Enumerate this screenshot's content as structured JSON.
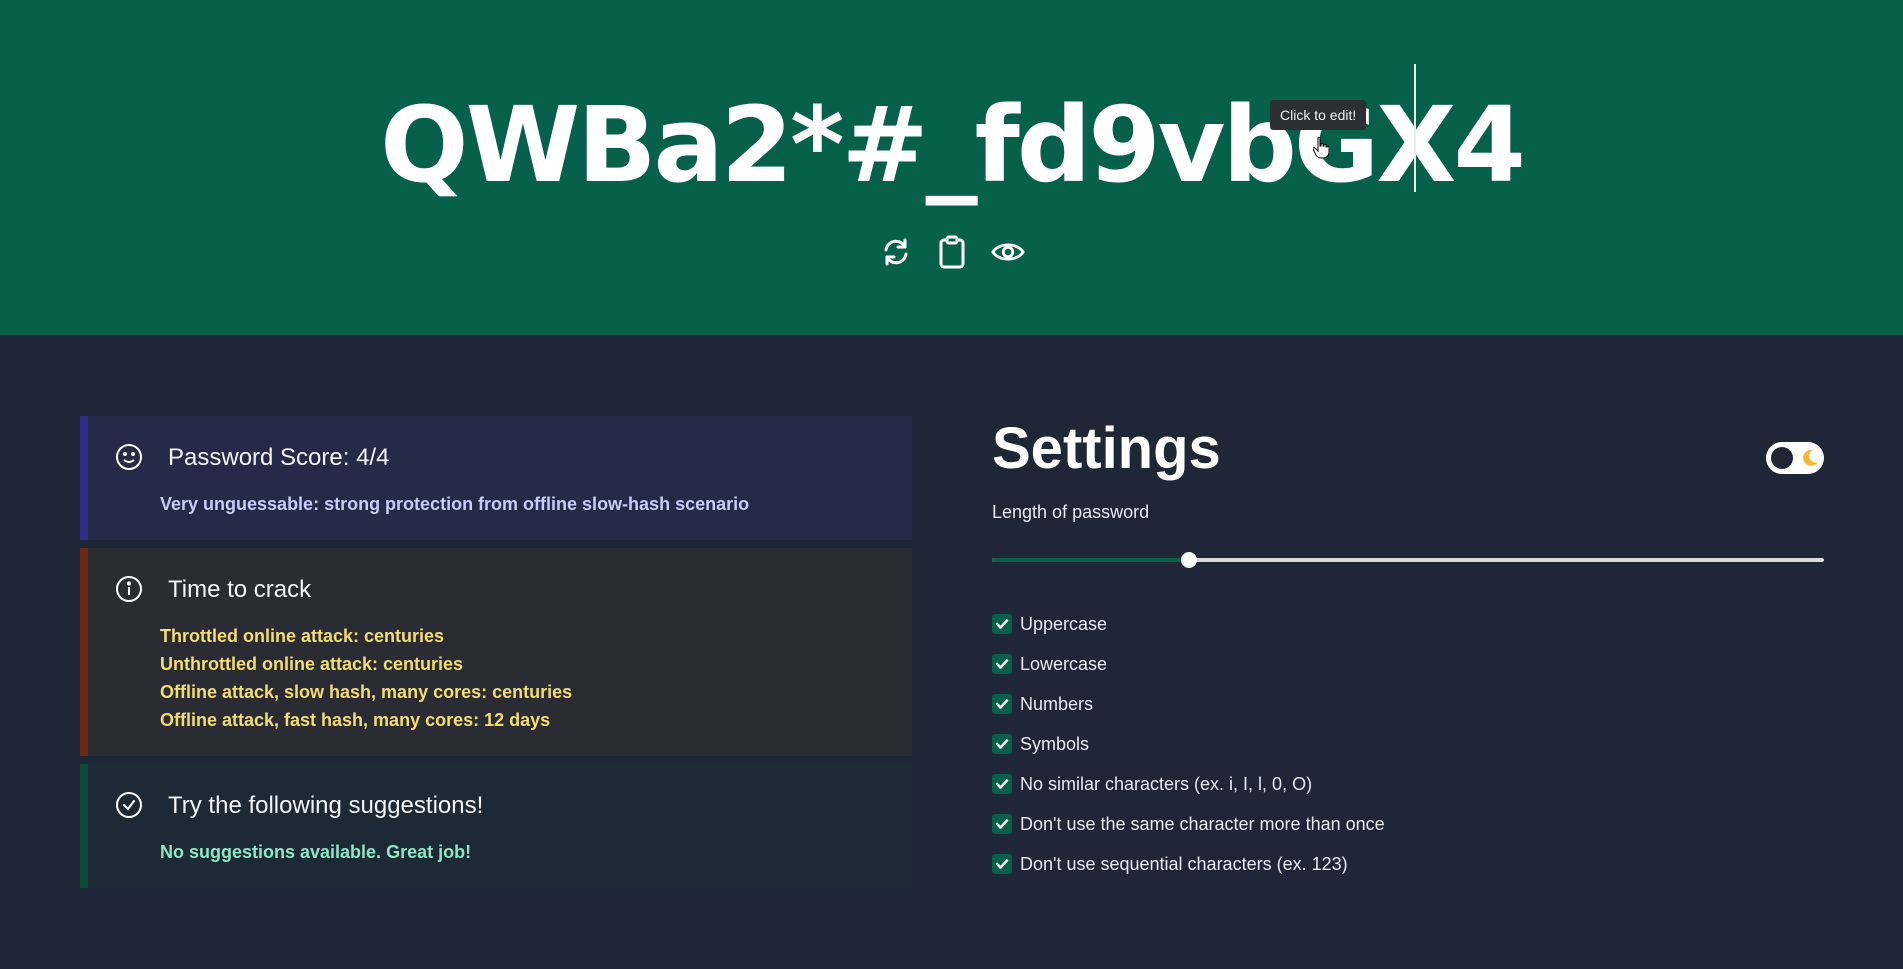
{
  "password": {
    "value": "QWBa2*#_fd9vbGX4",
    "tooltip": "Click to edit!"
  },
  "actions": [
    {
      "name": "regenerate-icon"
    },
    {
      "name": "clipboard-icon"
    },
    {
      "name": "eye-icon"
    }
  ],
  "cards": {
    "score": {
      "icon": "smile-icon",
      "title": "Password Score: 4/4",
      "lines": [
        "Very unguessable: strong protection from offline slow-hash scenario"
      ]
    },
    "crack": {
      "icon": "info-icon",
      "title": "Time to crack",
      "lines": [
        "Throttled online attack: centuries",
        "Unthrottled online attack: centuries",
        "Offline attack, slow hash, many cores: centuries",
        "Offline attack, fast hash, many cores: 12 days"
      ]
    },
    "suggestions": {
      "icon": "check-circle-icon",
      "title": "Try the following suggestions!",
      "lines": [
        "No suggestions available. Great job!"
      ]
    }
  },
  "settings": {
    "title": "Settings",
    "theme_toggle": {
      "state": "dark",
      "icon": "moon-icon"
    },
    "length_label": "Length of password",
    "length_fraction": 0.237,
    "options": [
      {
        "label": "Uppercase",
        "checked": true
      },
      {
        "label": "Lowercase",
        "checked": true
      },
      {
        "label": "Numbers",
        "checked": true
      },
      {
        "label": "Symbols",
        "checked": true
      },
      {
        "label": "No similar characters (ex. i, I, l, 0, O)",
        "checked": true
      },
      {
        "label": "Don't use the same character more than once",
        "checked": true
      },
      {
        "label": "Don't use sequential characters (ex. 123)",
        "checked": true
      }
    ]
  },
  "colors": {
    "header": "#06604a",
    "background": "#1f2737",
    "accent": "#06604a"
  }
}
